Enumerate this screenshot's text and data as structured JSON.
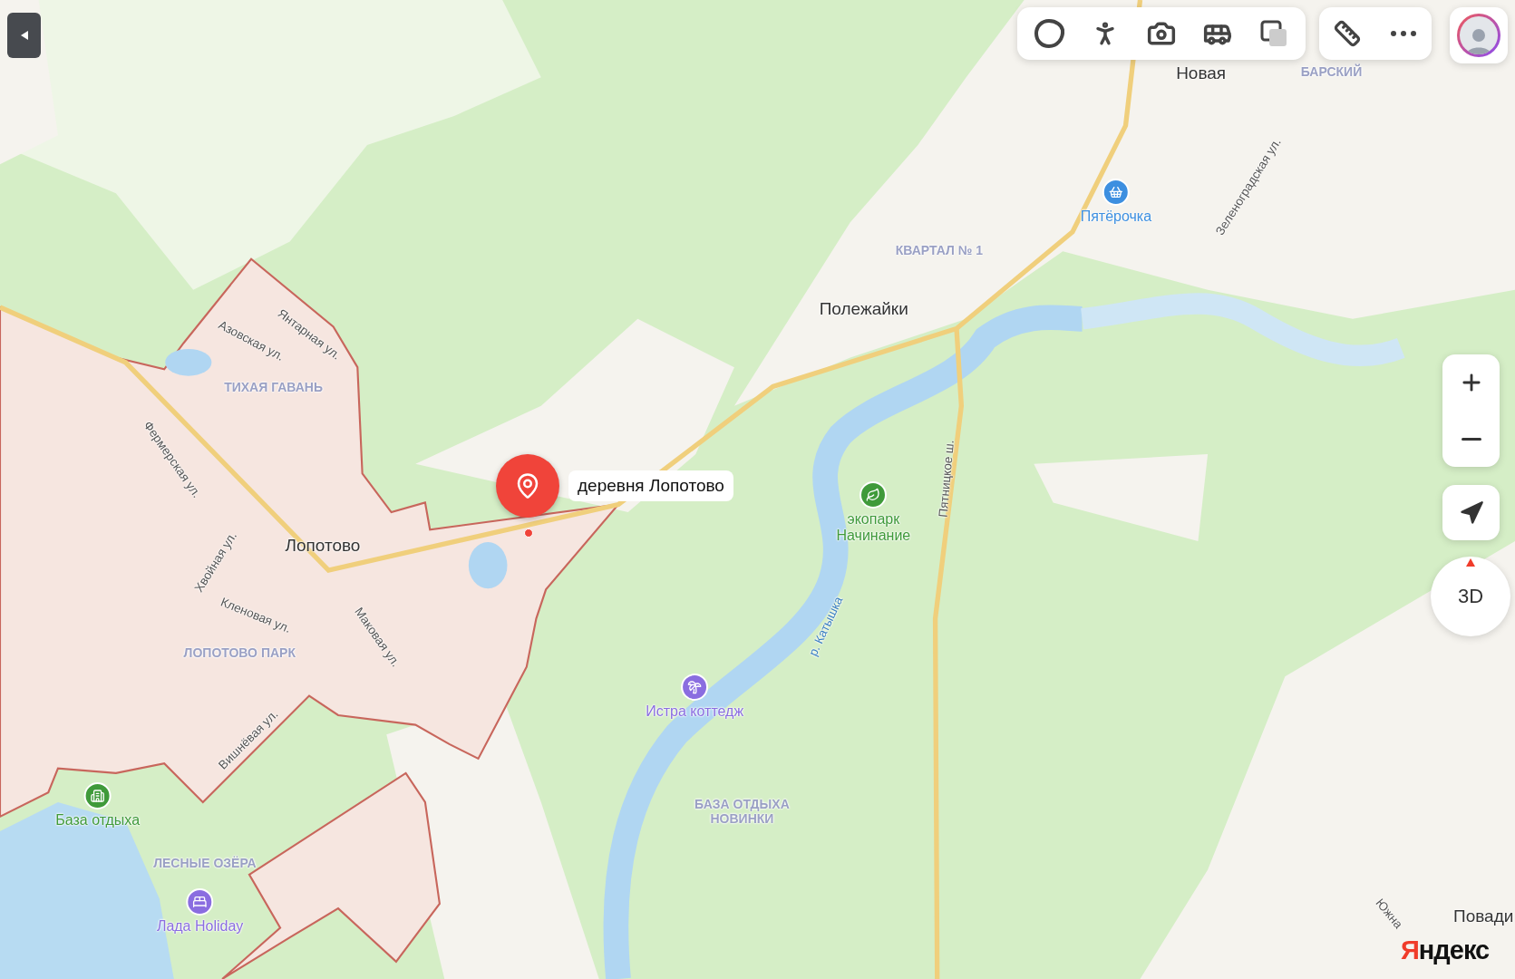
{
  "map": {
    "labels": [
      {
        "kind": "place",
        "text": "Новая"
      },
      {
        "kind": "district",
        "text": "БАРСКИЙ"
      },
      {
        "kind": "street",
        "text": "Зеленоградская ул."
      },
      {
        "kind": "district",
        "text": "КВАРТАЛ № 1"
      },
      {
        "kind": "place",
        "text": "Полежайки"
      },
      {
        "kind": "street",
        "text": "Янтарная ул."
      },
      {
        "kind": "street",
        "text": "Азовская ул."
      },
      {
        "kind": "district",
        "text": "ТИХАЯ ГАВАНЬ"
      },
      {
        "kind": "street",
        "text": "Фермерская ул."
      },
      {
        "kind": "place",
        "text": "Лопотово"
      },
      {
        "kind": "street",
        "text": "Хвойная ул."
      },
      {
        "kind": "street",
        "text": "Кленовая ул."
      },
      {
        "kind": "street",
        "text": "Маковая ул."
      },
      {
        "kind": "district",
        "text": "ЛОПОТОВО ПАРК"
      },
      {
        "kind": "street",
        "text": "Вишнёвая ул."
      },
      {
        "kind": "district",
        "text": "ЛЕСНЫЕ ОЗЁРА"
      },
      {
        "kind": "street",
        "text": "Пятницкое ш."
      },
      {
        "kind": "water",
        "text": "р. Катышка"
      },
      {
        "kind": "district",
        "text": "БАЗА ОТДЫХА НОВИНКИ"
      },
      {
        "kind": "street",
        "text": "Южна"
      },
      {
        "kind": "place",
        "text": "Повади"
      }
    ],
    "pois": [
      {
        "kind": "shop",
        "text": "Пятёрочка",
        "color": "#3d8fe0"
      },
      {
        "kind": "park",
        "text": "экопарк Начинание",
        "color": "#3f9a3a"
      },
      {
        "kind": "cottage",
        "text": "Истра коттедж",
        "color": "#8a6de0"
      },
      {
        "kind": "recreation",
        "text": "База отдыха",
        "color": "#3f9a3a"
      },
      {
        "kind": "hotel",
        "text": "Лада Holiday",
        "color": "#8a6de0"
      }
    ],
    "pin": {
      "label": "деревня Лопотово"
    },
    "compass": {
      "label": "3D"
    },
    "logo": {
      "accent": "Я",
      "rest": "ндекс"
    }
  }
}
